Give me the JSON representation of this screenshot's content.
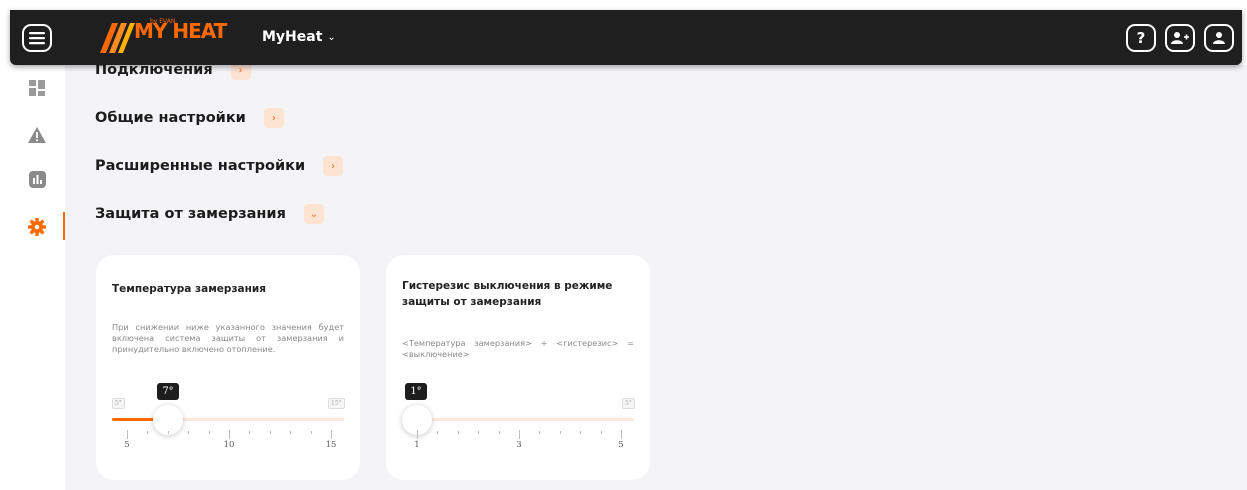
{
  "header": {
    "logo_text": "MY HEAT",
    "logo_sub": "by EVAN",
    "app_name": "MyHeat",
    "app_chevron": "⌄",
    "icons": [
      "menu-icon",
      "help-icon",
      "add-user-icon",
      "user-icon"
    ],
    "help_label": "?"
  },
  "sidebar": {
    "items": [
      {
        "name": "dashboard-icon"
      },
      {
        "name": "warning-icon"
      },
      {
        "name": "stats-icon"
      },
      {
        "name": "settings-icon",
        "active": true
      }
    ]
  },
  "sections": [
    {
      "title": "Подключения",
      "chevron": "›"
    },
    {
      "title": "Общие настройки",
      "chevron": "›"
    },
    {
      "title": "Расширенные настройки",
      "chevron": "›"
    },
    {
      "title": "Защита от замерзания",
      "chevron": "⌄"
    }
  ],
  "cards": [
    {
      "title": "Температура замерзания",
      "description": "При снижении ниже указанного значения будет включена система защиты от замерзания и принудительно включено отопление.",
      "value_label": "7°",
      "min_label": "5°",
      "max_label": "15°",
      "value": 7,
      "min": 5,
      "max": 15,
      "tick_labels": [
        "5",
        "10",
        "15"
      ]
    },
    {
      "title": "Гистерезис выключения в режиме защиты от замерзания",
      "description": "<Температура замерзания> + <гистерезис> = <выключение>",
      "value_label": "1°",
      "min_label": "",
      "max_label": "5°",
      "value": 1,
      "min": 1,
      "max": 5,
      "tick_labels": [
        "1",
        "3",
        "5"
      ]
    }
  ],
  "colors": {
    "accent": "#ff6a00",
    "header_bg": "#1f1f1f",
    "content_bg": "#f4f4f6"
  }
}
